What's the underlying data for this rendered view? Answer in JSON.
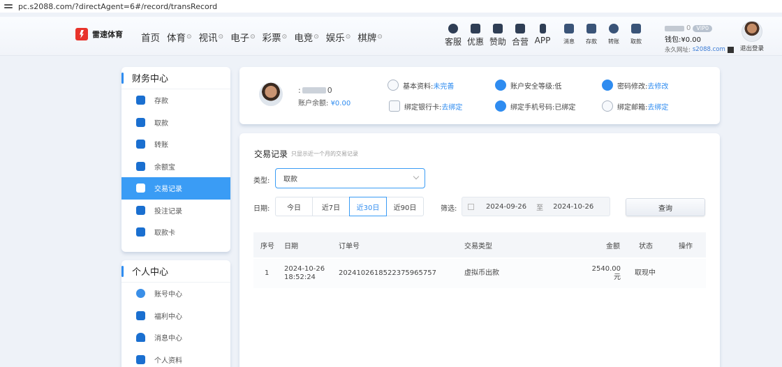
{
  "browser": {
    "url": "pc.s2088.com/?directAgent=6#/record/transRecord"
  },
  "header": {
    "logo_text": "雷速体育",
    "menu": [
      {
        "label": "首页",
        "arrow": ""
      },
      {
        "label": "体育",
        "arrow": "⊙"
      },
      {
        "label": "视讯",
        "arrow": "⊙"
      },
      {
        "label": "电子",
        "arrow": "⊙"
      },
      {
        "label": "彩票",
        "arrow": "⊙"
      },
      {
        "label": "电竞",
        "arrow": "⊙"
      },
      {
        "label": "娱乐",
        "arrow": "⊙"
      },
      {
        "label": "棋牌",
        "arrow": "⊙"
      }
    ],
    "quick": [
      {
        "label": "客服",
        "icon": "chat-icon"
      },
      {
        "label": "优惠",
        "icon": "gift-icon"
      },
      {
        "label": "赞助",
        "icon": "bookmark-icon"
      },
      {
        "label": "合营",
        "icon": "handshake-icon"
      },
      {
        "label": "APP",
        "icon": "phone-icon"
      }
    ],
    "quick_small": [
      {
        "label": "消息",
        "icon": "message-icon"
      },
      {
        "label": "存款",
        "icon": "deposit-icon"
      },
      {
        "label": "转账",
        "icon": "transfer-icon"
      },
      {
        "label": "取款",
        "icon": "withdraw-icon"
      }
    ],
    "user": {
      "name_suffix": "0",
      "vip": "VIP0",
      "wallet": "钱包:¥0.00",
      "domain_label": "永久网址:",
      "domain": "s2088.com",
      "logout": "退出登录"
    }
  },
  "sidebar": {
    "finance_title": "财务中心",
    "finance_items": [
      {
        "label": "存款",
        "active": false
      },
      {
        "label": "取款",
        "active": false
      },
      {
        "label": "转账",
        "active": false
      },
      {
        "label": "余额宝",
        "active": false
      },
      {
        "label": "交易记录",
        "active": true
      },
      {
        "label": "投注记录",
        "active": false
      },
      {
        "label": "取款卡",
        "active": false
      }
    ],
    "personal_title": "个人中心",
    "personal_items": [
      {
        "label": "账号中心"
      },
      {
        "label": "福利中心"
      },
      {
        "label": "消息中心"
      },
      {
        "label": "个人资料"
      }
    ]
  },
  "account": {
    "name_prefix": ":",
    "name_suffix": "0",
    "balance_label": "账户余额:",
    "balance_value": "¥0.00",
    "fields": [
      {
        "label": "基本资料:",
        "value": "未完善",
        "link": true
      },
      {
        "label": "账户安全等级:",
        "value": "低",
        "link": false
      },
      {
        "label": "密码修改:",
        "value": "去修改",
        "link": true
      },
      {
        "label": "绑定银行卡:",
        "value": "去绑定",
        "link": true
      },
      {
        "label": "绑定手机号码:",
        "value": "已绑定",
        "link": false
      },
      {
        "label": "绑定邮箱:",
        "value": "去绑定",
        "link": true
      }
    ]
  },
  "records": {
    "title": "交易记录",
    "subtitle": "只显示近一个月的交易记录",
    "type_label": "类型:",
    "type_value": "取款",
    "date_label": "日期:",
    "date_options": [
      "今日",
      "近7日",
      "近30日",
      "近90日"
    ],
    "date_selected": 2,
    "filter_label": "筛选:",
    "start_date": "2024-09-26",
    "range_sep": "至",
    "end_date": "2024-10-26",
    "query_button": "查询",
    "columns": [
      "序号",
      "日期",
      "订单号",
      "交易类型",
      "金额",
      "状态",
      "操作"
    ],
    "rows": [
      {
        "no": "1",
        "date": "2024-10-26",
        "time": "18:52:24",
        "order": "202410261852237596575 7",
        "type": "虚拟币出款",
        "amount": "2540.00",
        "unit": "元",
        "status": "取现中",
        "action": ""
      }
    ]
  }
}
